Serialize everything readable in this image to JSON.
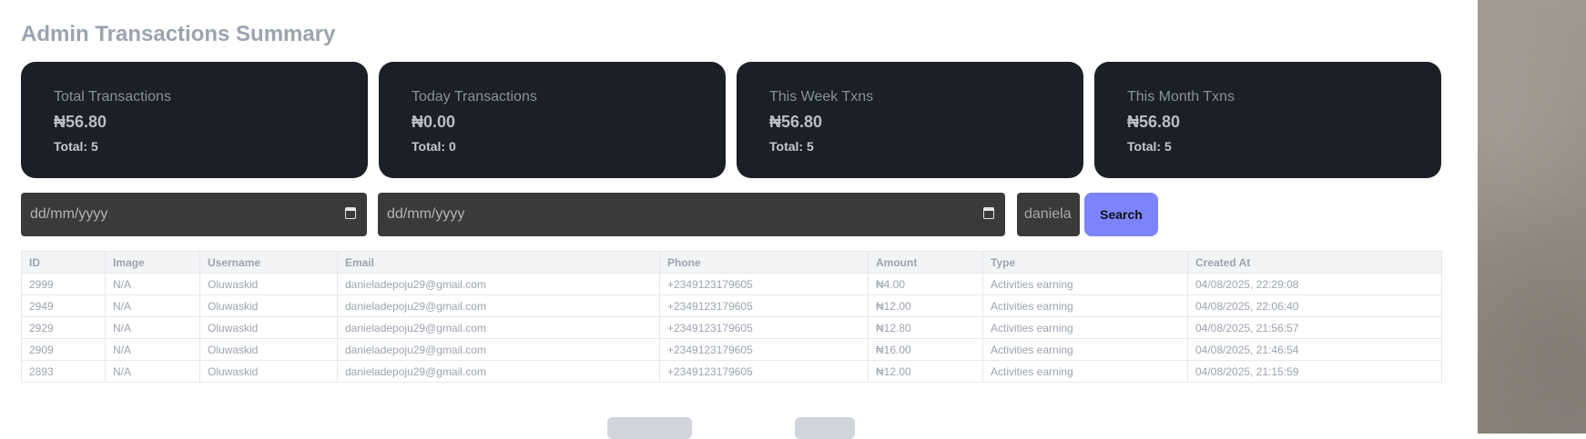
{
  "page": {
    "title": "Admin Transactions Summary"
  },
  "cards": [
    {
      "label": "Total Transactions",
      "amount": "₦56.80",
      "count": "Total: 5"
    },
    {
      "label": "Today Transactions",
      "amount": "₦0.00",
      "count": "Total: 0"
    },
    {
      "label": "This Week Txns",
      "amount": "₦56.80",
      "count": "Total: 5"
    },
    {
      "label": "This Month Txns",
      "amount": "₦56.80",
      "count": "Total: 5"
    }
  ],
  "filters": {
    "start_date_placeholder": "dd/mm/yyyy",
    "end_date_placeholder": "dd/mm/yyyy",
    "search_value": "daniela",
    "search_button": "Search"
  },
  "table": {
    "headers": [
      "ID",
      "Image",
      "Username",
      "Email",
      "Phone",
      "Amount",
      "Type",
      "Created At"
    ],
    "rows": [
      [
        "2999",
        "N/A",
        "Oluwaskid",
        "danieladepoju29@gmail.com",
        "+2349123179605",
        "₦4.00",
        "Activities earning",
        "04/08/2025, 22:29:08"
      ],
      [
        "2949",
        "N/A",
        "Oluwaskid",
        "danieladepoju29@gmail.com",
        "+2349123179605",
        "₦12.00",
        "Activities earning",
        "04/08/2025, 22:06:40"
      ],
      [
        "2929",
        "N/A",
        "Oluwaskid",
        "danieladepoju29@gmail.com",
        "+2349123179605",
        "₦12.80",
        "Activities earning",
        "04/08/2025, 21:56:57"
      ],
      [
        "2909",
        "N/A",
        "Oluwaskid",
        "danieladepoju29@gmail.com",
        "+2349123179605",
        "₦16.00",
        "Activities earning",
        "04/08/2025, 21:46:54"
      ],
      [
        "2893",
        "N/A",
        "Oluwaskid",
        "danieladepoju29@gmail.com",
        "+2349123179605",
        "₦12.00",
        "Activities earning",
        "04/08/2025, 21:15:59"
      ]
    ]
  },
  "icons": {
    "date_picker": "calendar-icon"
  },
  "colors": {
    "card_bg": "#1b1f26",
    "accent": "#7c83fd",
    "input_bg": "#3a3a3a"
  }
}
